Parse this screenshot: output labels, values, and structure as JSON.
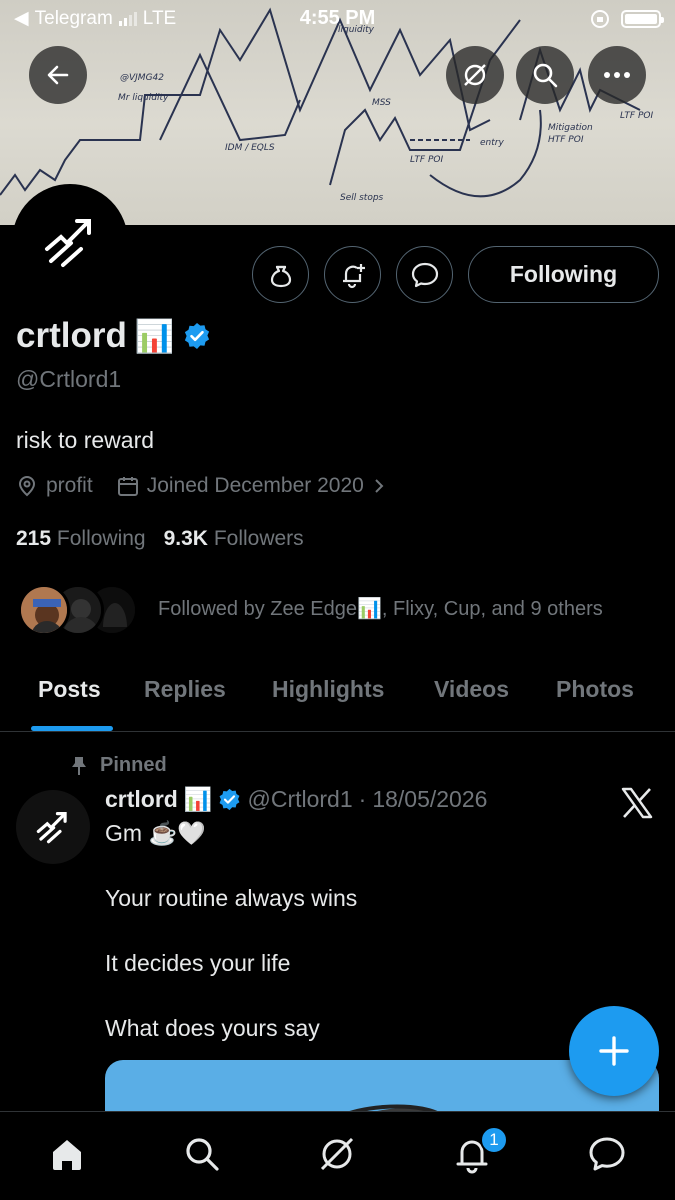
{
  "status_bar": {
    "back_app": "Telegram",
    "network": "LTE",
    "time": "4:55 PM"
  },
  "profile": {
    "display_name": "crtlord",
    "name_emoji": "📊",
    "handle": "@Crtlord1",
    "bio": "risk to reward",
    "location": "profit",
    "joined": "Joined December 2020",
    "following_count": "215",
    "following_label": "Following",
    "followers_count": "9.3K",
    "followers_label": "Followers",
    "followed_by": "Followed by Zee Edge📊, Flixy, Cup, and 9 others",
    "following_button": "Following",
    "verified_color": "#1d9bf0"
  },
  "tabs": [
    {
      "label": "Posts",
      "active": true
    },
    {
      "label": "Replies",
      "active": false
    },
    {
      "label": "Highlights",
      "active": false
    },
    {
      "label": "Videos",
      "active": false
    },
    {
      "label": "Photos",
      "active": false
    }
  ],
  "post": {
    "pinned_label": "Pinned",
    "author_name": "crtlord",
    "author_emoji": "📊",
    "author_handle": "@Crtlord1",
    "separator": "·",
    "date": "18/05/2026",
    "lines": [
      "Gm ☕️🤍",
      "Your routine always wins",
      "It decides your life",
      "What does yours say"
    ]
  },
  "notifications_badge": "1",
  "icons": {
    "header": [
      "back-arrow-icon",
      "grok-icon",
      "search-icon",
      "more-icon"
    ],
    "actions": [
      "tip-jar-icon",
      "notification-bell-plus-icon",
      "message-icon"
    ],
    "nav": [
      "home-icon",
      "search-icon",
      "grok-icon",
      "bell-icon",
      "messages-icon"
    ]
  },
  "colors": {
    "accent": "#1d9bf0",
    "muted": "#71767b",
    "text": "#e7e9ea",
    "background": "#000000"
  }
}
